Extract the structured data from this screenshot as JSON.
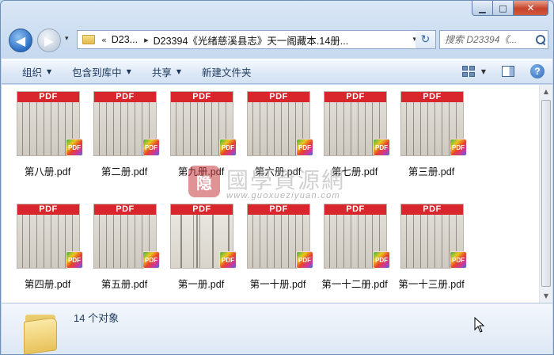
{
  "titlebar": {
    "minimize_glyph": "▁",
    "maximize_glyph": "□",
    "close_glyph": "✕"
  },
  "nav": {
    "back_glyph": "◀",
    "forward_glyph": "▶",
    "recent_glyph": "▾",
    "breadcrumb_overflow": "«",
    "breadcrumb": [
      "D23...",
      "D23394《光绪慈溪县志》天一阁藏本.14册..."
    ],
    "breadcrumb_sep": "▸",
    "address_dropdown_glyph": "▾",
    "refresh_glyph": "↻",
    "search_placeholder": "搜索 D23394《..."
  },
  "toolbar": {
    "organize": "组织",
    "include_in_library": "包含到库中",
    "share": "共享",
    "new_folder": "新建文件夹",
    "caret": "▼",
    "help": "?"
  },
  "files": [
    {
      "name": "第八册.pdf",
      "thumb_label": "PDF",
      "badge": "PDF"
    },
    {
      "name": "第二册.pdf",
      "thumb_label": "PDF",
      "badge": "PDF"
    },
    {
      "name": "第九册.pdf",
      "thumb_label": "PDF",
      "badge": "PDF"
    },
    {
      "name": "第六册.pdf",
      "thumb_label": "PDF",
      "badge": "PDF"
    },
    {
      "name": "第七册.pdf",
      "thumb_label": "PDF",
      "badge": "PDF"
    },
    {
      "name": "第三册.pdf",
      "thumb_label": "PDF",
      "badge": "PDF"
    },
    {
      "name": "第四册.pdf",
      "thumb_label": "PDF",
      "badge": "PDF"
    },
    {
      "name": "第五册.pdf",
      "thumb_label": "PDF",
      "badge": "PDF"
    },
    {
      "name": "第一册.pdf",
      "thumb_label": "PDF",
      "badge": "PDF"
    },
    {
      "name": "第一十册.pdf",
      "thumb_label": "PDF",
      "badge": "PDF"
    },
    {
      "name": "第一十二册.pdf",
      "thumb_label": "PDF",
      "badge": "PDF"
    },
    {
      "name": "第一十三册.pdf",
      "thumb_label": "PDF",
      "badge": "PDF"
    }
  ],
  "watermark": {
    "seal": "隐",
    "title": "國學資源網",
    "url": "www.guoxueziyuan.com"
  },
  "scrollbar": {
    "up_glyph": "▲",
    "down_glyph": "▼"
  },
  "status": {
    "item_count": "14 个对象"
  },
  "colors": {
    "pdf_red": "#d8262c",
    "accent": "#1e395b"
  }
}
